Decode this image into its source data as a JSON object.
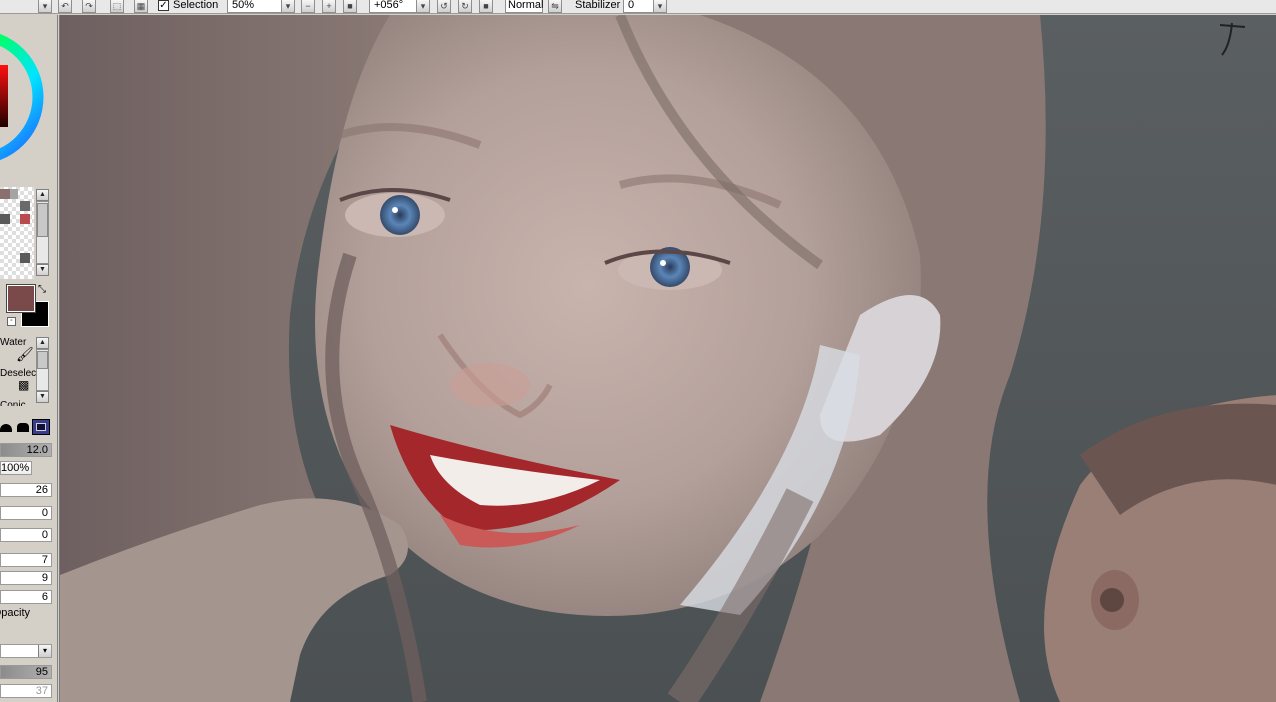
{
  "toolbar": {
    "selection_label": "Selection",
    "selection_checked": true,
    "zoom_value": "50%",
    "rotation_value": "+056°",
    "blend_mode": "Normal",
    "stabilizer_label": "Stabilizer",
    "stabilizer_value": "0"
  },
  "tools": {
    "tool1_label": "Water",
    "tool2_label": "Deselect",
    "tool3_label": "Conic"
  },
  "colors": {
    "foreground": "#7a4a4b",
    "background": "#000000",
    "swatches": [
      "#8a6f6f",
      "#a4a4a4",
      "#6a6a6a",
      "#b94b50",
      "#5a5a5a",
      "#3a3a3a"
    ]
  },
  "brush": {
    "size": "12.0",
    "density": "100%",
    "values": [
      "26",
      "0",
      "0",
      "7",
      "9",
      "6"
    ],
    "opacity_label": "Opacity",
    "opacity_value": "95",
    "next_value": "37"
  }
}
